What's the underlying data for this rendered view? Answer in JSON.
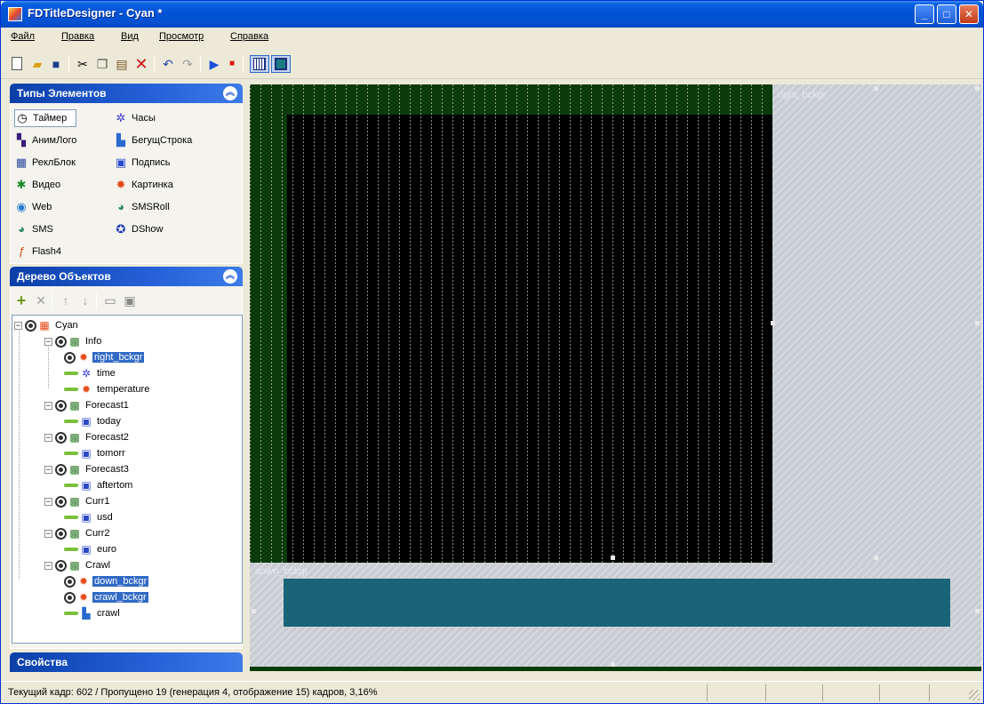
{
  "window": {
    "title": "FDTitleDesigner - Cyan *",
    "controls": {
      "minimize": "_",
      "maximize": "□",
      "close": "✕"
    }
  },
  "menu": [
    "Файл",
    "Правка",
    "Вид",
    "Просмотр",
    "Справка"
  ],
  "toolbar": {
    "icons": [
      "new-file",
      "open-folder",
      "save",
      "cut",
      "copy",
      "paste",
      "delete",
      "undo",
      "redo",
      "play",
      "stop",
      "layout-view",
      "fill-view"
    ]
  },
  "element_types": {
    "title": "Типы Элементов",
    "items": [
      {
        "label": "Таймер",
        "icon": "timer-icon",
        "selected": true
      },
      {
        "label": "Часы",
        "icon": "clock-icon"
      },
      {
        "label": "АнимЛого",
        "icon": "animlogo-icon"
      },
      {
        "label": "БегущСтрока",
        "icon": "ticker-icon"
      },
      {
        "label": "РеклБлок",
        "icon": "adblock-icon"
      },
      {
        "label": "Подпись",
        "icon": "caption-icon"
      },
      {
        "label": "Видео",
        "icon": "video-icon"
      },
      {
        "label": "Картинка",
        "icon": "picture-icon"
      },
      {
        "label": "Web",
        "icon": "web-icon"
      },
      {
        "label": "SMSRoll",
        "icon": "smsroll-icon"
      },
      {
        "label": "SMS",
        "icon": "sms-icon"
      },
      {
        "label": "DShow",
        "icon": "dshow-icon"
      },
      {
        "label": "Flash4",
        "icon": "flash-icon"
      }
    ]
  },
  "object_tree": {
    "title": "Дерево Объектов",
    "toolbar": [
      "add",
      "remove",
      "move-up",
      "move-down",
      "open",
      "save"
    ],
    "nodes": [
      {
        "label": "Cyan",
        "type": "root"
      },
      {
        "label": "Info",
        "type": "group"
      },
      {
        "label": "right_bckgr",
        "type": "picture",
        "highlighted": true
      },
      {
        "label": "time",
        "type": "clock"
      },
      {
        "label": "temperature",
        "type": "picture"
      },
      {
        "label": "Forecast1",
        "type": "group"
      },
      {
        "label": "today",
        "type": "caption"
      },
      {
        "label": "Forecast2",
        "type": "group"
      },
      {
        "label": "tomorr",
        "type": "caption"
      },
      {
        "label": "Forecast3",
        "type": "group"
      },
      {
        "label": "aftertom",
        "type": "caption"
      },
      {
        "label": "Curr1",
        "type": "group"
      },
      {
        "label": "usd",
        "type": "caption"
      },
      {
        "label": "Curr2",
        "type": "group"
      },
      {
        "label": "euro",
        "type": "caption"
      },
      {
        "label": "Crawl",
        "type": "group"
      },
      {
        "label": "down_bckgr",
        "type": "picture",
        "highlighted": true
      },
      {
        "label": "crawl_bckgr",
        "type": "picture",
        "highlighted": true
      },
      {
        "label": "crawl",
        "type": "ticker"
      }
    ]
  },
  "canvas": {
    "right_label": "right_bckgr",
    "down_label": "down_bckgr"
  },
  "properties": {
    "title": "Свойства"
  },
  "status": {
    "text": "Текущий кадр: 602 / Пропущено 19 (генерация 4, отображение 15) кадров,  3,16%"
  }
}
